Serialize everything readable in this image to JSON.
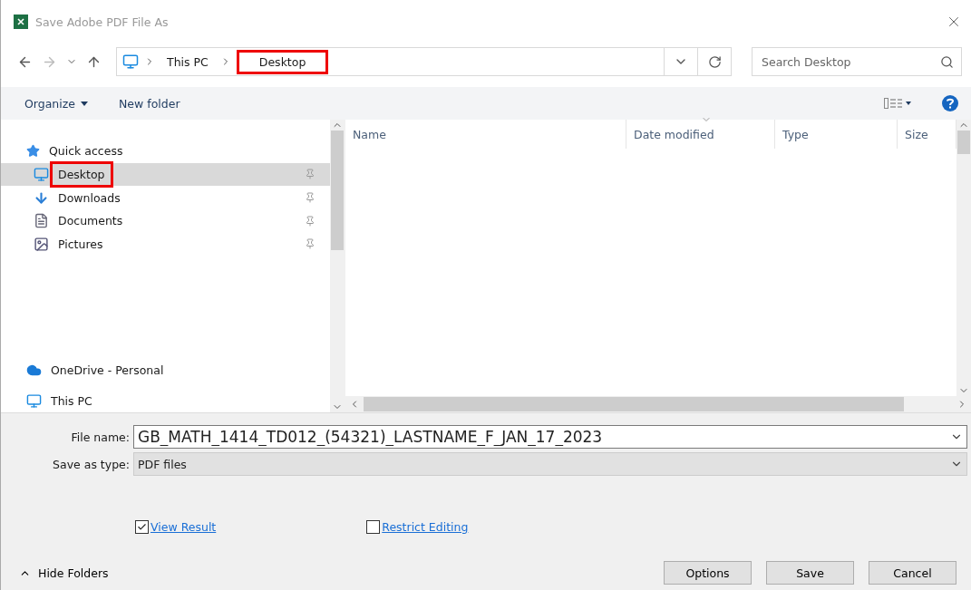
{
  "window": {
    "title": "Save Adobe PDF File As"
  },
  "address_bar": {
    "breadcrumbs": [
      {
        "label": "This PC",
        "highlighted": false
      },
      {
        "label": "Desktop",
        "highlighted": true
      }
    ]
  },
  "search": {
    "placeholder": "Search Desktop"
  },
  "toolbar": {
    "buttons": [
      "Organize",
      "New folder"
    ]
  },
  "sidebar": {
    "items": [
      {
        "label": "Quick access",
        "kind": "star",
        "children": [
          {
            "label": "Desktop",
            "kind": "desktop",
            "selected": true,
            "highlighted": true
          },
          {
            "label": "Downloads",
            "kind": "download",
            "selected": false,
            "highlighted": false
          },
          {
            "label": "Documents",
            "kind": "document",
            "selected": false,
            "highlighted": false
          },
          {
            "label": "Pictures",
            "kind": "picture",
            "selected": false,
            "highlighted": false
          }
        ]
      },
      {
        "label": "OneDrive - Personal",
        "kind": "cloud"
      },
      {
        "label": "This PC",
        "kind": "desktop"
      }
    ]
  },
  "columns": [
    {
      "label": "Name",
      "sorted": false
    },
    {
      "label": "Date modified",
      "sorted": true
    },
    {
      "label": "Type",
      "sorted": false
    },
    {
      "label": "Size",
      "sorted": false
    }
  ],
  "file_name": {
    "label": "File name:",
    "value": "GB_MATH_1414_TD012_(54321)_LASTNAME_F_JAN_17_2023"
  },
  "save_as_type": {
    "label": "Save as type:",
    "value": "PDF files"
  },
  "options": [
    {
      "label": "View Result",
      "checked": true
    },
    {
      "label": "Restrict Editing",
      "checked": false
    }
  ],
  "hide_folders": "Hide Folders",
  "buttons": [
    "Options",
    "Save",
    "Cancel"
  ]
}
